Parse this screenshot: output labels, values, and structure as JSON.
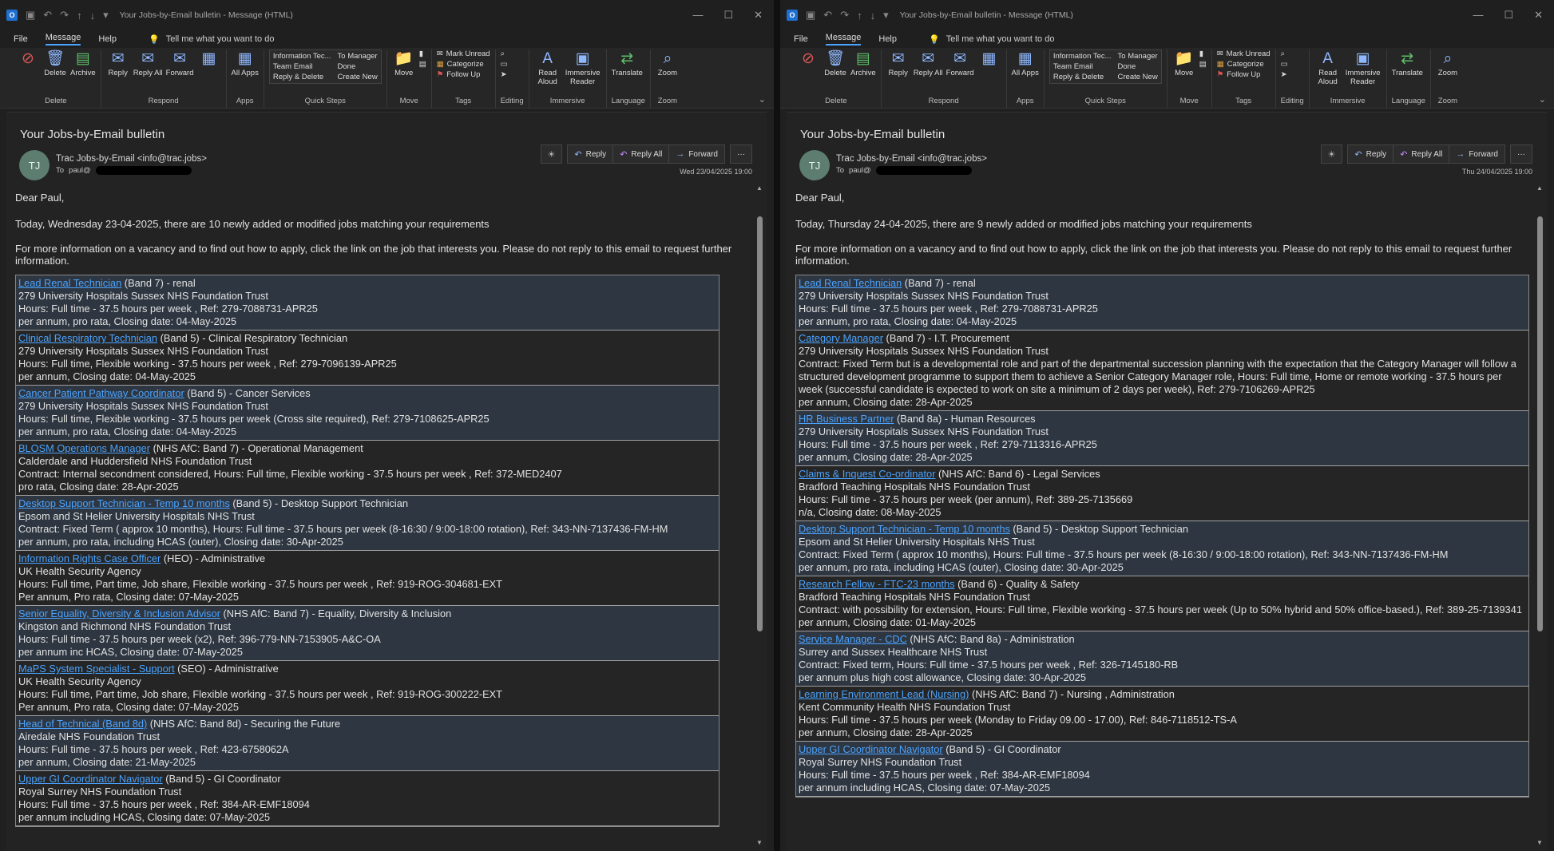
{
  "left": {
    "title": "Your Jobs-by-Email bulletin  -  Message (HTML)",
    "menu": [
      "File",
      "Message",
      "Help"
    ],
    "tellme": "Tell me what you want to do",
    "ribbon": {
      "delete": "Delete",
      "archive": "Archive",
      "delete_group": "Delete",
      "reply": "Reply",
      "reply_all": "Reply All",
      "forward": "Forward",
      "respond_group": "Respond",
      "all_apps": "All Apps",
      "apps_group": "Apps",
      "qs1": "Information Tec...",
      "qs2": "To Manager",
      "qs3": "Team Email",
      "qs4": "Done",
      "qs5": "Reply & Delete",
      "qs6": "Create New",
      "qs_group": "Quick Steps",
      "move": "Move",
      "move_group": "Move",
      "mark_unread": "Mark Unread",
      "categorize": "Categorize",
      "follow_up": "Follow Up",
      "tags_group": "Tags",
      "editing_group": "Editing",
      "read_aloud": "Read Aloud",
      "immersive_reader": "Immersive Reader",
      "immersive_group": "Immersive",
      "translate": "Translate",
      "language_group": "Language",
      "zoom": "Zoom",
      "zoom_group": "Zoom"
    },
    "subject": "Your Jobs-by-Email bulletin",
    "avatar": "TJ",
    "sender": "Trac Jobs-by-Email <info@trac.jobs>",
    "to_label": "To",
    "to_name": "paul@",
    "actions": {
      "reply": "Reply",
      "reply_all": "Reply All",
      "forward": "Forward",
      "more": "···"
    },
    "datetime": "Wed 23/04/2025 19:00",
    "greeting": "Dear Paul,",
    "intro1": "Today, Wednesday 23-04-2025, there are 10 newly added or modified jobs matching your requirements",
    "intro2": "For more information on a vacancy and to find out how to apply, click the link on the job that interests you. Please do not reply to this email to request further information.",
    "jobs": [
      {
        "title": "Lead Renal Technician",
        "band": " (Band 7) - renal",
        "org": "279 University Hospitals Sussex NHS Foundation Trust",
        "details": "Hours: Full time - 37.5 hours per week , Ref: 279-7088731-APR25",
        "closing": "per annum, pro rata, Closing date: 04-May-2025"
      },
      {
        "title": "Clinical Respiratory Technician",
        "band": " (Band 5) - Clinical Respiratory Technician",
        "org": "279 University Hospitals Sussex NHS Foundation Trust",
        "details": "Hours: Full time, Flexible working - 37.5 hours per week , Ref: 279-7096139-APR25",
        "closing": "per annum, Closing date: 04-May-2025"
      },
      {
        "title": "Cancer Patient Pathway Coordinator",
        "band": " (Band 5) - Cancer Services",
        "org": "279 University Hospitals Sussex NHS Foundation Trust",
        "details": "Hours: Full time, Flexible working - 37.5 hours per week (Cross site required), Ref: 279-7108625-APR25",
        "closing": "per annum, pro rata, Closing date: 04-May-2025"
      },
      {
        "title": "BLOSM Operations Manager",
        "band": " (NHS AfC: Band 7) - Operational Management",
        "org": "Calderdale and Huddersfield NHS Foundation Trust",
        "details": "Contract: Internal secondment considered, Hours: Full time, Flexible working - 37.5 hours per week , Ref: 372-MED2407",
        "closing": "pro rata, Closing date: 28-Apr-2025"
      },
      {
        "title": "Desktop Support Technician - Temp 10 months",
        "band": " (Band 5) - Desktop Support Technician",
        "org": "Epsom and St Helier University Hospitals NHS Trust",
        "details": "Contract: Fixed Term ( approx 10 months), Hours: Full time - 37.5 hours per week (8-16:30 / 9:00-18:00 rotation), Ref: 343-NN-7137436-FM-HM",
        "closing": "per annum, pro rata, including HCAS (outer), Closing date: 30-Apr-2025"
      },
      {
        "title": "Information Rights Case Officer",
        "band": " (HEO) - Administrative",
        "org": "UK Health Security Agency",
        "details": "Hours: Full time, Part time, Job share, Flexible working - 37.5 hours per week , Ref: 919-ROG-304681-EXT",
        "closing": "Per annum, Pro rata, Closing date: 07-May-2025"
      },
      {
        "title": "Senior Equality, Diversity & Inclusion Advisor",
        "band": " (NHS AfC: Band 7) - Equality, Diversity & Inclusion",
        "org": "Kingston and Richmond NHS Foundation Trust",
        "details": "Hours: Full time - 37.5 hours per week (x2), Ref: 396-779-NN-7153905-A&C-OA",
        "closing": "per annum inc HCAS, Closing date: 07-May-2025"
      },
      {
        "title": "MaPS System Specialist - Support",
        "band": " (SEO) - Administrative",
        "org": "UK Health Security Agency",
        "details": "Hours: Full time, Part time, Job share, Flexible working - 37.5 hours per week , Ref: 919-ROG-300222-EXT",
        "closing": "Per annum, Pro rata, Closing date: 07-May-2025"
      },
      {
        "title": "Head of Technical (Band 8d)",
        "band": " (NHS AfC: Band 8d) - Securing the Future",
        "org": "Airedale NHS Foundation Trust",
        "details": "Hours: Full time - 37.5 hours per week , Ref: 423-6758062A",
        "closing": "per annum, Closing date: 21-May-2025"
      },
      {
        "title": "Upper GI Coordinator Navigator",
        "band": " (Band 5) - GI Coordinator",
        "org": "Royal Surrey NHS Foundation Trust",
        "details": "Hours: Full time - 37.5 hours per week , Ref: 384-AR-EMF18094",
        "closing": "per annum including HCAS, Closing date: 07-May-2025"
      }
    ]
  },
  "right": {
    "title": "Your Jobs-by-Email bulletin  -  Message (HTML)",
    "menu": [
      "File",
      "Message",
      "Help"
    ],
    "tellme": "Tell me what you want to do",
    "ribbon": {
      "delete": "Delete",
      "archive": "Archive",
      "delete_group": "Delete",
      "reply": "Reply",
      "reply_all": "Reply All",
      "forward": "Forward",
      "respond_group": "Respond",
      "all_apps": "All Apps",
      "apps_group": "Apps",
      "qs1": "Information Tec...",
      "qs2": "To Manager",
      "qs3": "Team Email",
      "qs4": "Done",
      "qs5": "Reply & Delete",
      "qs6": "Create New",
      "qs_group": "Quick Steps",
      "move": "Move",
      "move_group": "Move",
      "mark_unread": "Mark Unread",
      "categorize": "Categorize",
      "follow_up": "Follow Up",
      "tags_group": "Tags",
      "editing_group": "Editing",
      "read_aloud": "Read Aloud",
      "immersive_reader": "Immersive Reader",
      "immersive_group": "Immersive",
      "translate": "Translate",
      "language_group": "Language",
      "zoom": "Zoom",
      "zoom_group": "Zoom"
    },
    "subject": "Your Jobs-by-Email bulletin",
    "avatar": "TJ",
    "sender": "Trac Jobs-by-Email <info@trac.jobs>",
    "to_label": "To",
    "to_name": "paul@",
    "actions": {
      "reply": "Reply",
      "reply_all": "Reply All",
      "forward": "Forward",
      "more": "···"
    },
    "datetime": "Thu 24/04/2025 19:00",
    "greeting": "Dear Paul,",
    "intro1": "Today, Thursday 24-04-2025, there are 9 newly added or modified jobs matching your requirements",
    "intro2": "For more information on a vacancy and to find out how to apply, click the link on the job that interests you. Please do not reply to this email to request further information.",
    "jobs": [
      {
        "title": "Lead Renal Technician",
        "band": " (Band 7) - renal",
        "org": "279 University Hospitals Sussex NHS Foundation Trust",
        "details": "Hours: Full time - 37.5 hours per week , Ref: 279-7088731-APR25",
        "closing": "per annum, pro rata, Closing date: 04-May-2025"
      },
      {
        "title": "Category Manager",
        "band": " (Band 7) - I.T. Procurement",
        "org": "279 University Hospitals Sussex NHS Foundation Trust",
        "details": "Contract: Fixed Term but is a developmental role and part of the departmental succession planning with the expectation that the Category Manager will follow a structured development programme to support them to achieve a Senior Category Manager role, Hours: Full time, Home or remote working - 37.5 hours per week (successful candidate is expected to work on site a minimum of 2 days per week), Ref: 279-7106269-APR25",
        "closing": "per annum, Closing date: 28-Apr-2025"
      },
      {
        "title": "HR Business Partner",
        "band": " (Band 8a) - Human Resources",
        "org": "279 University Hospitals Sussex NHS Foundation Trust",
        "details": "Hours: Full time - 37.5 hours per week , Ref: 279-7113316-APR25",
        "closing": "per annum, Closing date: 28-Apr-2025"
      },
      {
        "title": "Claims & Inquest Co-ordinator",
        "band": " (NHS AfC: Band 6) - Legal Services",
        "org": "Bradford Teaching Hospitals NHS Foundation Trust",
        "details": "Hours: Full time - 37.5 hours per week (per annum), Ref: 389-25-7135669",
        "closing": "n/a, Closing date: 08-May-2025"
      },
      {
        "title": "Desktop Support Technician - Temp 10 months",
        "band": " (Band 5) - Desktop Support Technician",
        "org": "Epsom and St Helier University Hospitals NHS Trust",
        "details": "Contract: Fixed Term ( approx 10 months), Hours: Full time - 37.5 hours per week (8-16:30 / 9:00-18:00 rotation), Ref: 343-NN-7137436-FM-HM",
        "closing": "per annum, pro rata, including HCAS (outer), Closing date: 30-Apr-2025"
      },
      {
        "title": "Research Fellow - FTC-23 months",
        "band": " (Band 6) - Quality & Safety",
        "org": "Bradford Teaching Hospitals NHS Foundation Trust",
        "details": "Contract: with possibility for extension, Hours: Full time, Flexible working - 37.5 hours per week (Up to 50% hybrid and 50% office-based.), Ref: 389-25-7139341",
        "closing": "per annum, Closing date: 01-May-2025"
      },
      {
        "title": "Service Manager - CDC",
        "band": " (NHS AfC: Band 8a) - Administration",
        "org": "Surrey and Sussex Healthcare NHS Trust",
        "details": "Contract: Fixed term, Hours: Full time - 37.5 hours per week , Ref: 326-7145180-RB",
        "closing": "per annum plus high cost allowance, Closing date: 30-Apr-2025"
      },
      {
        "title": "Learning Environment Lead (Nursing)",
        "band": " (NHS AfC: Band 7) - Nursing , Administration",
        "org": "Kent Community Health NHS Foundation Trust",
        "details": "Hours: Full time - 37.5 hours per week (Monday to Friday 09.00 - 17.00), Ref: 846-7118512-TS-A",
        "closing": "per annum, Closing date: 28-Apr-2025"
      },
      {
        "title": "Upper GI Coordinator Navigator",
        "band": " (Band 5) - GI Coordinator",
        "org": "Royal Surrey NHS Foundation Trust",
        "details": "Hours: Full time - 37.5 hours per week , Ref: 384-AR-EMF18094",
        "closing": "per annum including HCAS, Closing date: 07-May-2025"
      }
    ]
  }
}
